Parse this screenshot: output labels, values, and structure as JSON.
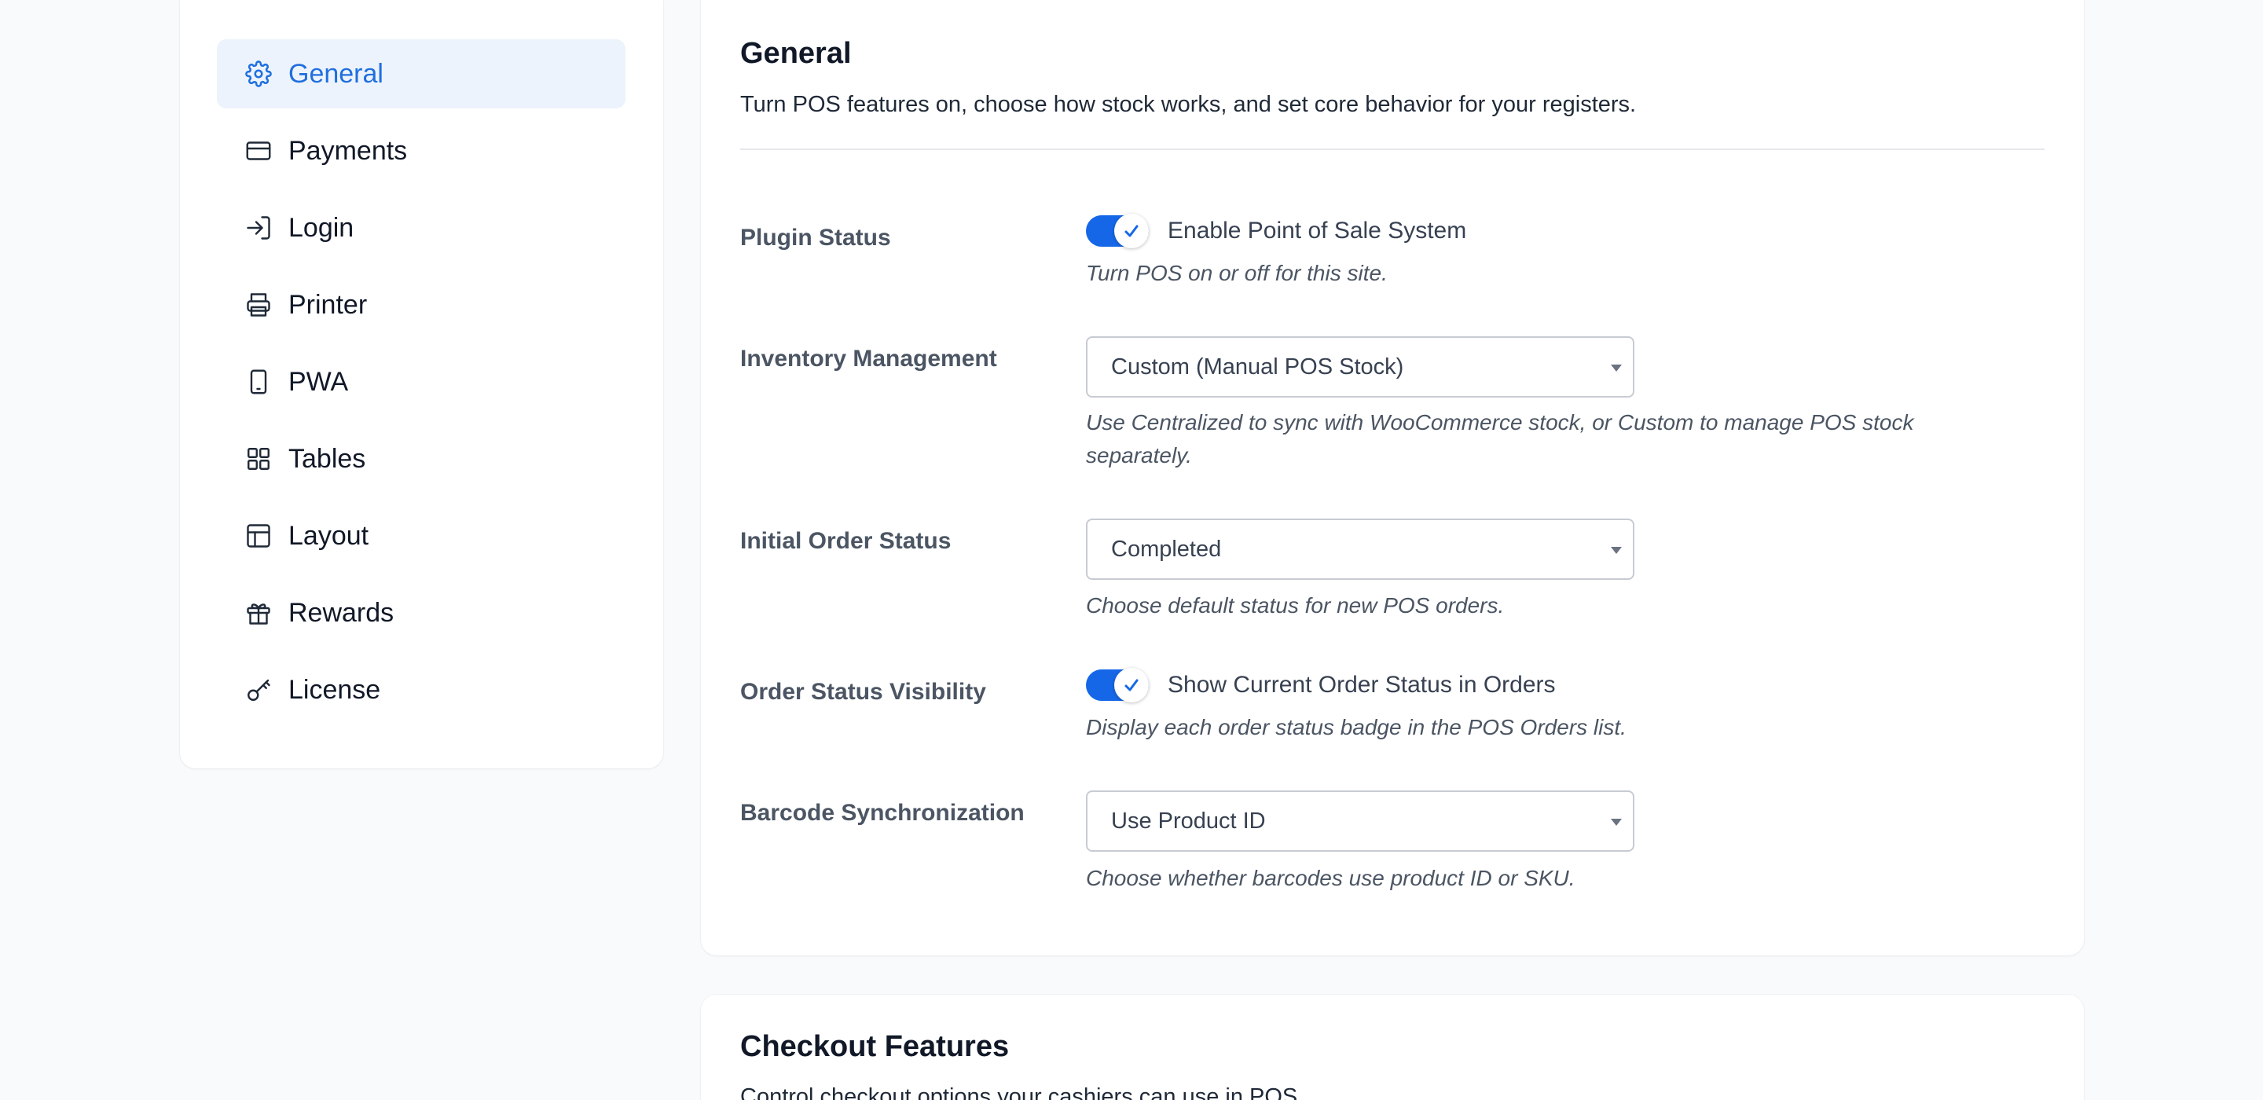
{
  "sidebar": {
    "items": [
      {
        "label": "General",
        "icon": "gear-icon",
        "active": true
      },
      {
        "label": "Payments",
        "icon": "credit-card-icon"
      },
      {
        "label": "Login",
        "icon": "login-icon"
      },
      {
        "label": "Printer",
        "icon": "printer-icon"
      },
      {
        "label": "PWA",
        "icon": "mobile-icon"
      },
      {
        "label": "Tables",
        "icon": "grid-icon"
      },
      {
        "label": "Layout",
        "icon": "layout-icon"
      },
      {
        "label": "Rewards",
        "icon": "gift-icon"
      },
      {
        "label": "License",
        "icon": "key-icon"
      }
    ]
  },
  "general": {
    "title": "General",
    "description": "Turn POS features on, choose how stock works, and set core behavior for your registers.",
    "plugin_status": {
      "label": "Plugin Status",
      "toggle_label": "Enable Point of Sale System",
      "enabled": true,
      "help": "Turn POS on or off for this site."
    },
    "inventory": {
      "label": "Inventory Management",
      "value": "Custom (Manual POS Stock)",
      "help": "Use Centralized to sync with WooCommerce stock, or Custom to manage POS stock separately."
    },
    "initial_order_status": {
      "label": "Initial Order Status",
      "value": "Completed",
      "help": "Choose default status for new POS orders."
    },
    "order_status_visibility": {
      "label": "Order Status Visibility",
      "toggle_label": "Show Current Order Status in Orders",
      "enabled": true,
      "help": "Display each order status badge in the POS Orders list."
    },
    "barcode": {
      "label": "Barcode Synchronization",
      "value": "Use Product ID",
      "help": "Choose whether barcodes use product ID or SKU."
    }
  },
  "checkout": {
    "title": "Checkout Features",
    "description": "Control checkout options your cashiers can use in POS."
  },
  "colors": {
    "accent": "#1667e8",
    "active_nav_bg": "#edf3fd",
    "active_nav_text": "#1f6fde",
    "page_bg": "#f8fafc"
  }
}
